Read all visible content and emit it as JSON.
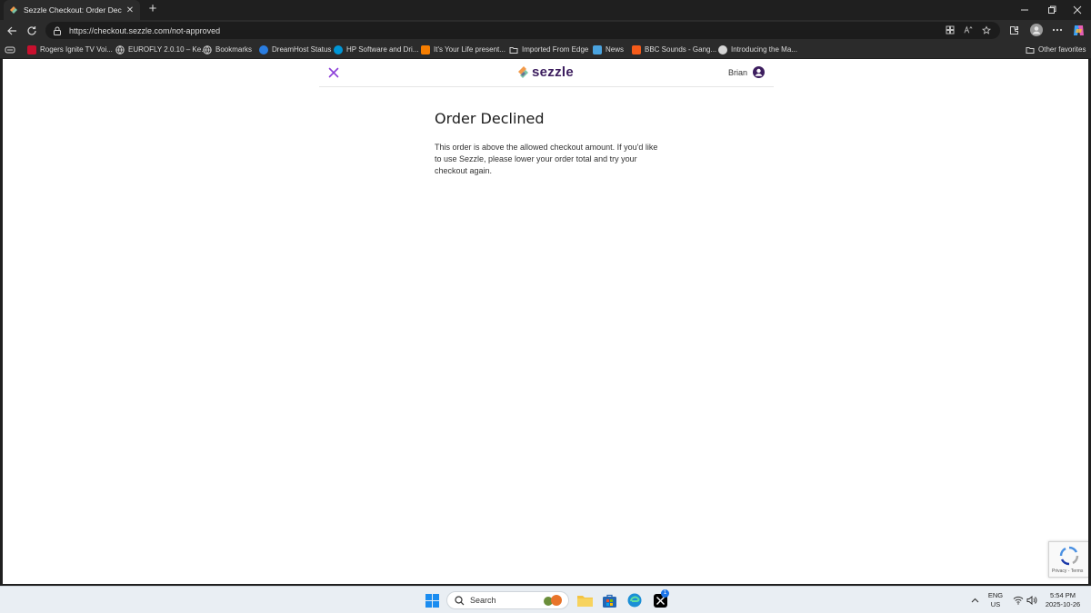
{
  "browser": {
    "tab": {
      "title": "Sezzle Checkout: Order Declined"
    },
    "address_bar": {
      "url": "https://checkout.sezzle.com/not-approved"
    },
    "bookmarks": [
      {
        "label": "Rogers Ignite TV Voi..."
      },
      {
        "label": "EUROFLY 2.0.10 – Ke..."
      },
      {
        "label": "Bookmarks"
      },
      {
        "label": "DreamHost Status"
      },
      {
        "label": "HP Software and Dri..."
      },
      {
        "label": "It's Your Life present..."
      },
      {
        "label": "Imported From Edge"
      },
      {
        "label": "News"
      },
      {
        "label": "BBC Sounds - Gang..."
      },
      {
        "label": "Introducing the Ma..."
      }
    ],
    "other_favorites": "Other favorites"
  },
  "page": {
    "logo_text": "sezzle",
    "user_name": "Brian",
    "heading": "Order Declined",
    "message": "This order is above the allowed checkout amount. If you'd like to use Sezzle, please lower your order total and try your checkout again.",
    "recaptcha_text": "Privacy - Terms"
  },
  "taskbar": {
    "search_label": "Search",
    "language": "ENG",
    "region": "US",
    "time": "5:54 PM",
    "date": "2025-10-26",
    "x_badge": "1"
  },
  "colors": {
    "brand": "#3c1d5e",
    "close_x": "#8c3fd9",
    "browser_bg": "#2b2b2b"
  }
}
